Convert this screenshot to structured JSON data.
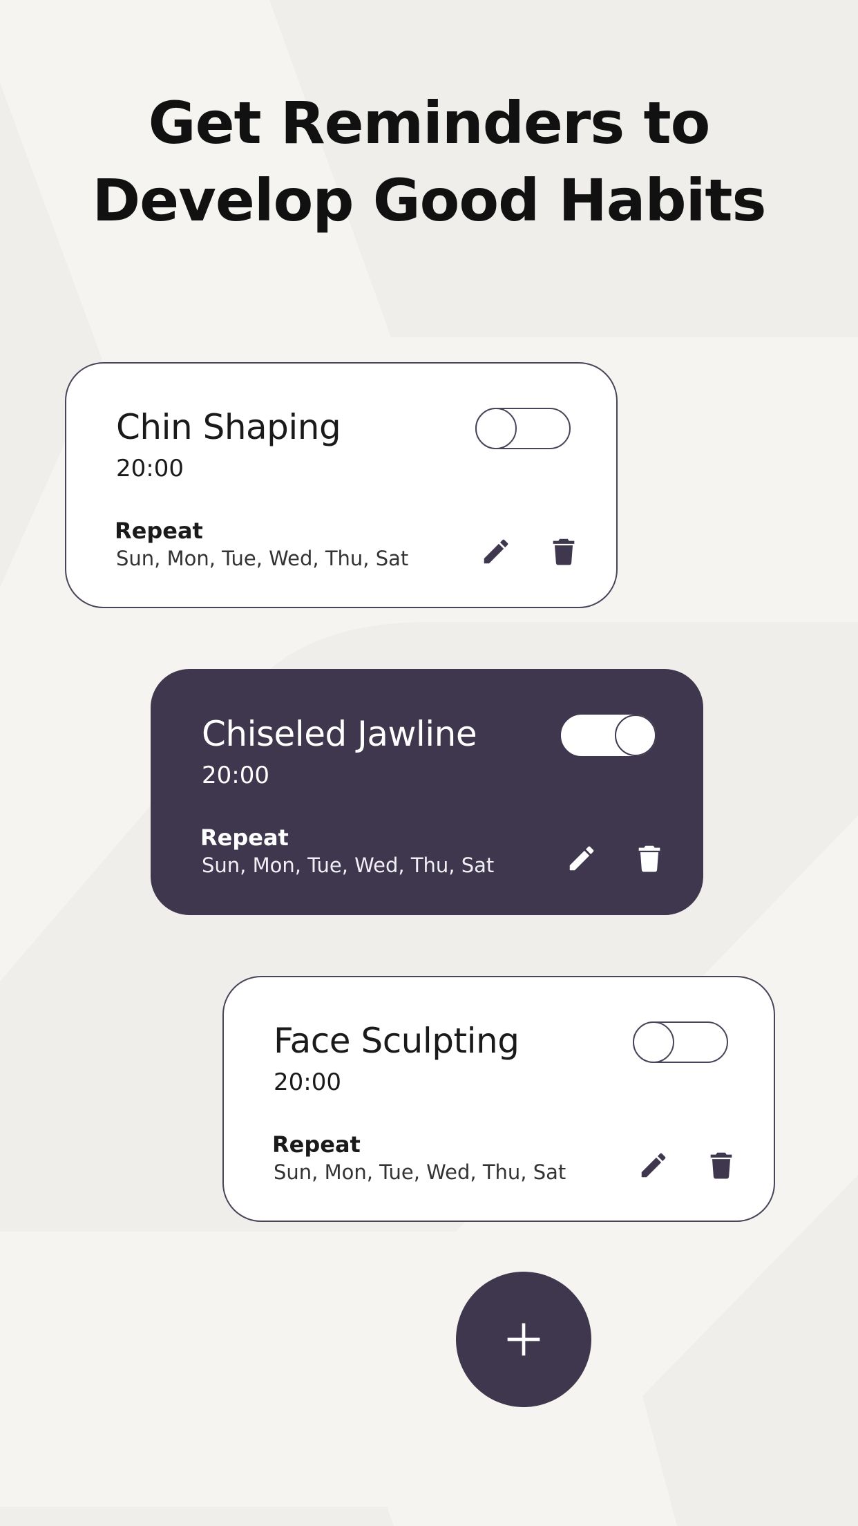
{
  "headline": {
    "line1": "Get Reminders to",
    "line2": "Develop Good Habits"
  },
  "reminders": [
    {
      "title": "Chin Shaping",
      "time": "20:00",
      "repeat_label": "Repeat",
      "repeat_days": "Sun, Mon, Tue, Wed, Thu, Sat",
      "enabled": false,
      "style": "light"
    },
    {
      "title": "Chiseled Jawline",
      "time": "20:00",
      "repeat_label": "Repeat",
      "repeat_days": "Sun, Mon, Tue, Wed, Thu, Sat",
      "enabled": true,
      "style": "dark"
    },
    {
      "title": "Face Sculpting",
      "time": "20:00",
      "repeat_label": "Repeat",
      "repeat_days": "Sun, Mon, Tue, Wed, Thu, Sat",
      "enabled": false,
      "style": "light"
    }
  ],
  "icons": {
    "edit": "pencil-icon",
    "delete": "trash-icon",
    "add": "plus-icon"
  },
  "colors": {
    "background": "#f5f4f0",
    "accent_dark": "#3e374d",
    "card_light": "#ffffff",
    "text_dark": "#111111"
  }
}
